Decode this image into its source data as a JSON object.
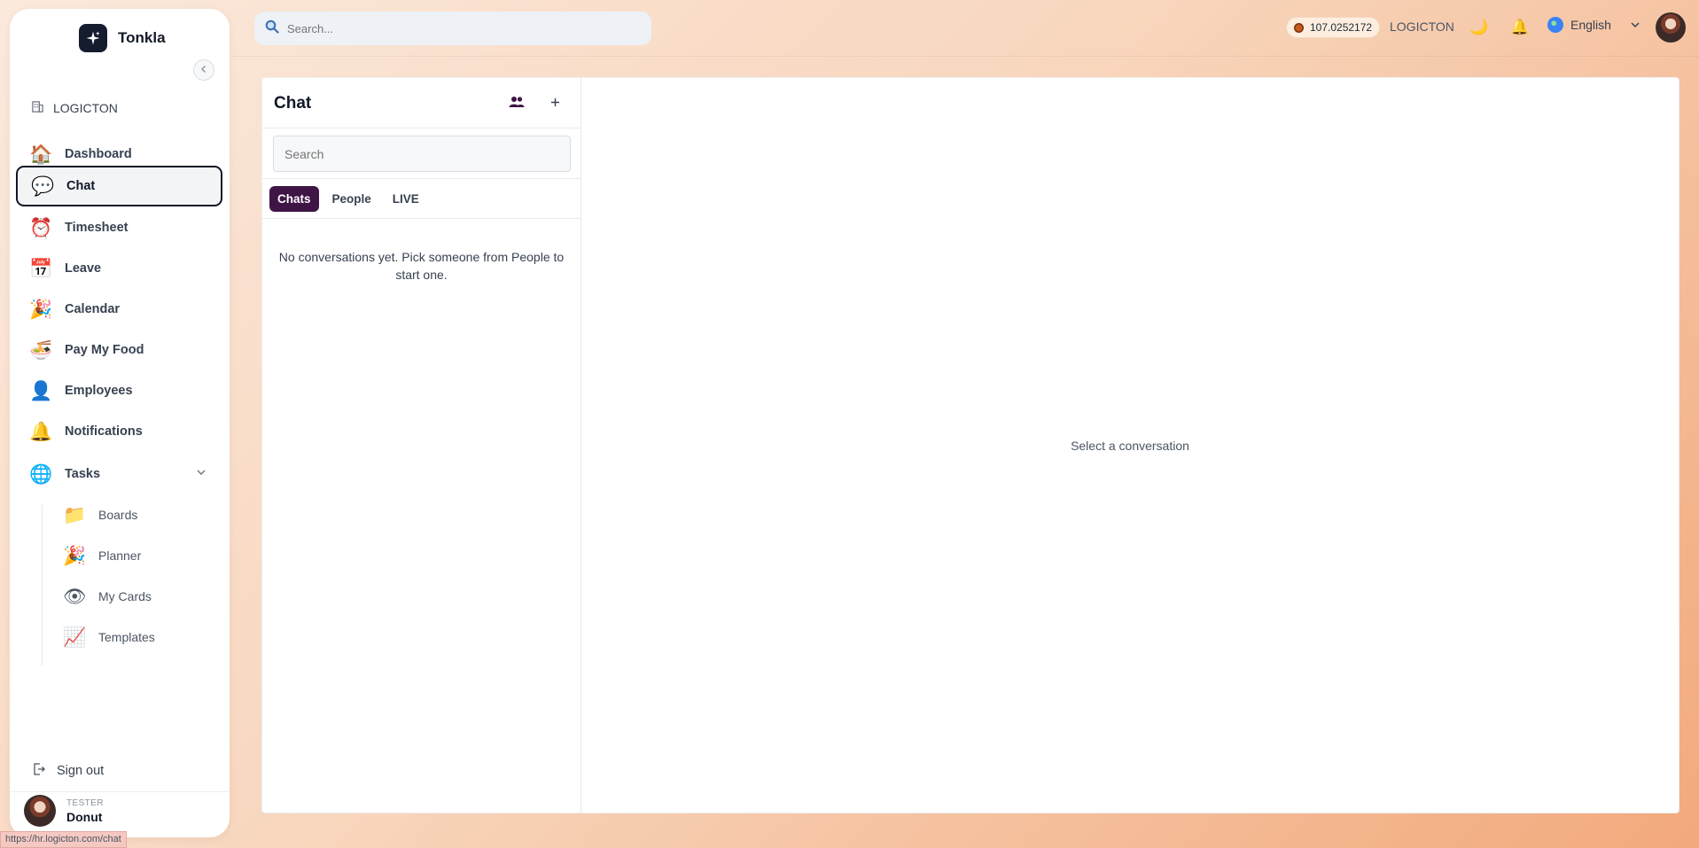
{
  "app": {
    "name": "Tonkla",
    "org_name": "LOGICTON"
  },
  "sidebar": {
    "items": [
      {
        "label": "Dashboard",
        "icon": "house-icon",
        "glyph": "🏠"
      },
      {
        "label": "Chat",
        "icon": "chat-bubbles-icon",
        "glyph": "💬"
      },
      {
        "label": "Timesheet",
        "icon": "alarm-clock-icon",
        "glyph": "⏰"
      },
      {
        "label": "Leave",
        "icon": "calendar-grid-icon",
        "glyph": "📅"
      },
      {
        "label": "Calendar",
        "icon": "party-popper-icon",
        "glyph": "🎉"
      },
      {
        "label": "Pay My Food",
        "icon": "noodle-bowl-icon",
        "glyph": "🍜"
      },
      {
        "label": "Employees",
        "icon": "person-icon",
        "glyph": "👤"
      },
      {
        "label": "Notifications",
        "icon": "bell-icon",
        "glyph": "🔔"
      },
      {
        "label": "Tasks",
        "icon": "color-grid-icon",
        "glyph": "🌐"
      }
    ],
    "tasks_children": [
      {
        "label": "Boards",
        "icon": "folder-icon",
        "glyph": "📁"
      },
      {
        "label": "Planner",
        "icon": "party-popper-icon",
        "glyph": "🎉"
      },
      {
        "label": "My Cards",
        "icon": "eye-icon",
        "glyph": "👁"
      },
      {
        "label": "Templates",
        "icon": "chart-increasing-icon",
        "glyph": "📈"
      }
    ],
    "sign_out": "Sign out",
    "user": {
      "role": "TESTER",
      "name": "Donut"
    }
  },
  "status_bar": {
    "url": "https://hr.logicton.com/chat"
  },
  "topbar": {
    "search_placeholder": "Search...",
    "balance": "107.0252172",
    "org_name": "LOGICTON",
    "language": "English",
    "moon_glyph": "🌙",
    "bell_glyph": "🔔"
  },
  "chat": {
    "title": "Chat",
    "search_placeholder": "Search",
    "tabs": [
      "Chats",
      "People",
      "LIVE"
    ],
    "active_tab": "Chats",
    "empty_message": "No conversations yet. Pick someone from People to start one.",
    "placeholder": "Select a conversation"
  },
  "colors": {
    "accent_tab": "#3e1545",
    "brand_logo_bg": "#141c2e"
  }
}
